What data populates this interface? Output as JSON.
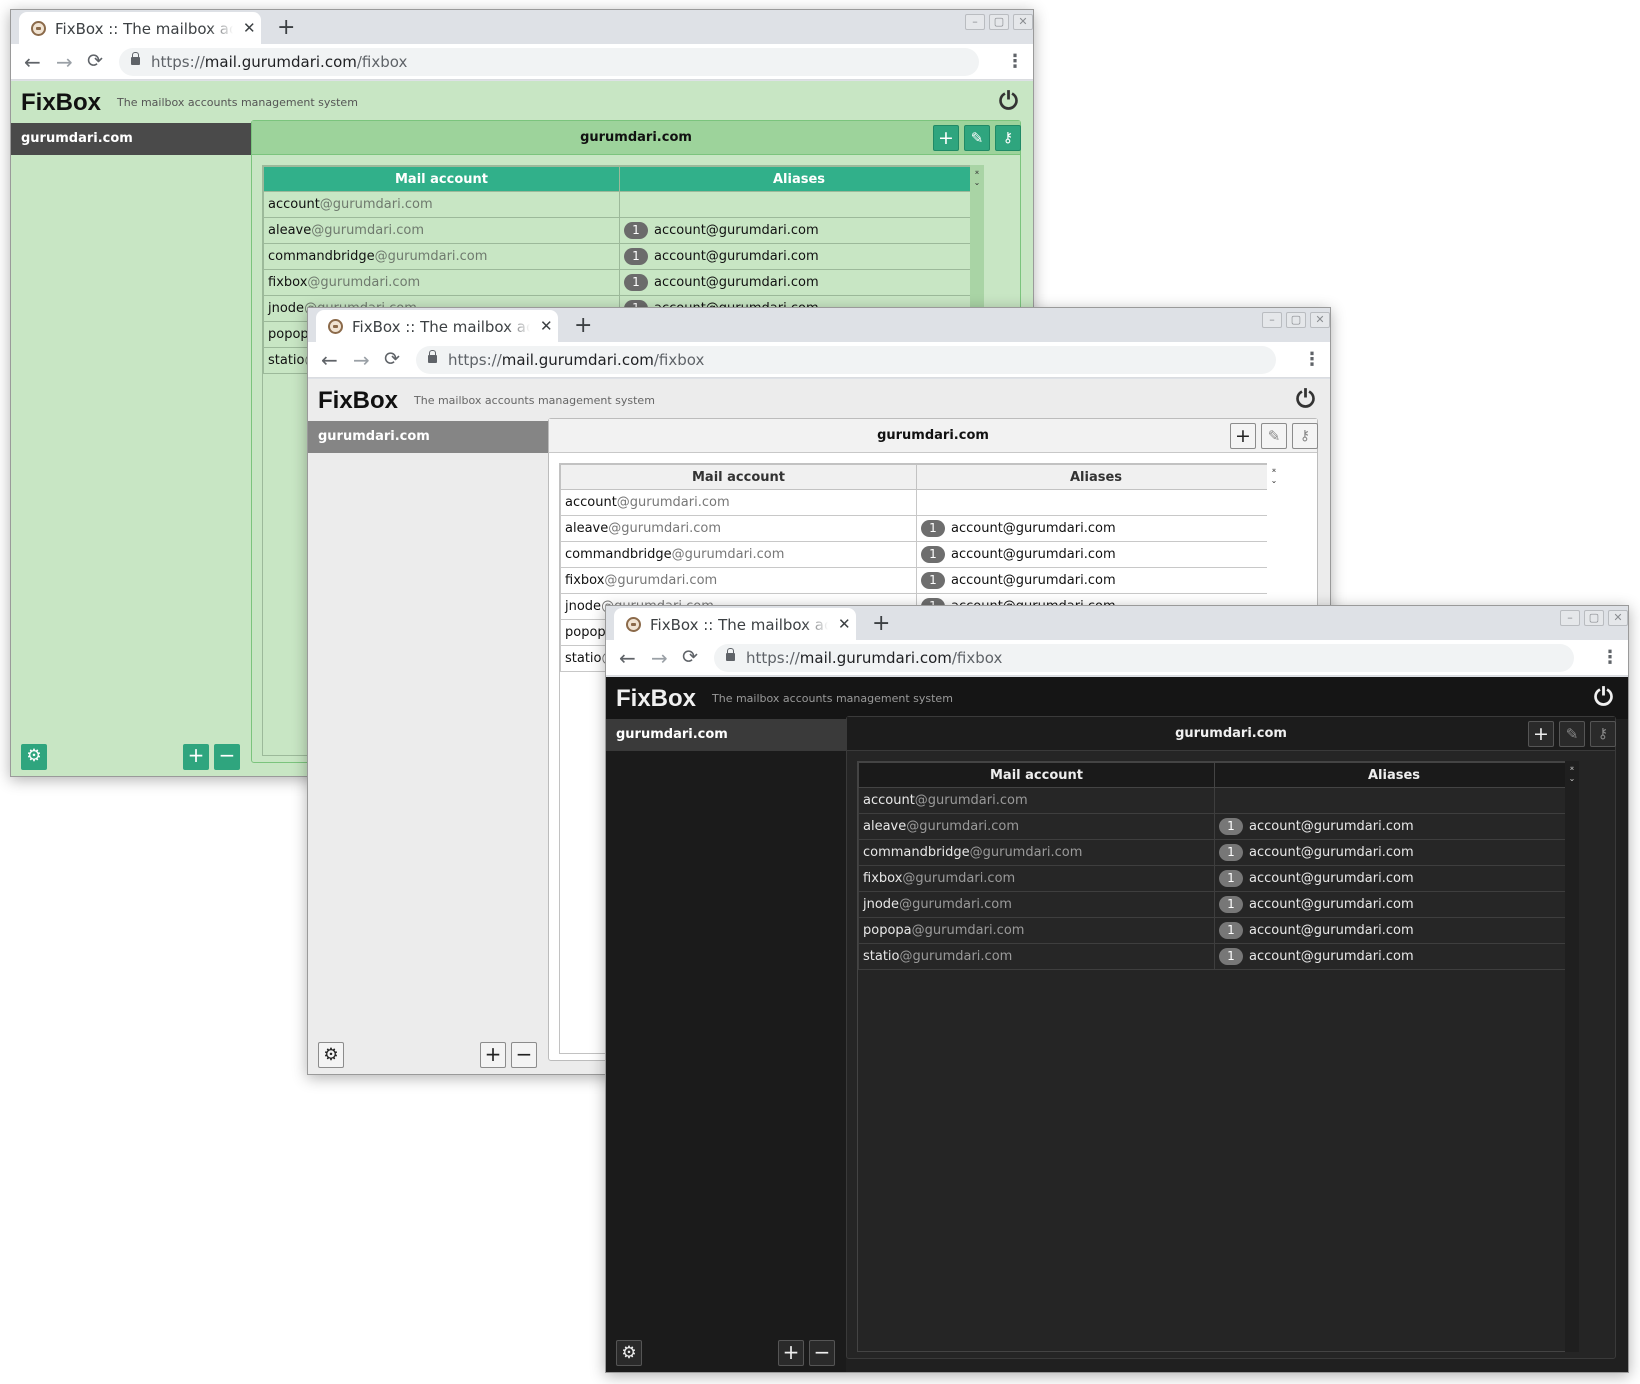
{
  "browser": {
    "tab_title": "FixBox :: The mailbox accounts management system",
    "url_scheme": "https://",
    "url_host": "mail.gurumdari.com",
    "url_path": "/fixbox"
  },
  "app": {
    "logo": "FixBox",
    "subtitle": "The mailbox accounts management system"
  },
  "sidebar": {
    "domains": [
      "gurumdari.com"
    ]
  },
  "panel": {
    "title": "gurumdari.com",
    "columns": [
      "Mail account",
      "Aliases"
    ],
    "rows": [
      {
        "user": "account",
        "domain": "@gurumdari.com",
        "alias_count": "",
        "alias": ""
      },
      {
        "user": "aleave",
        "domain": "@gurumdari.com",
        "alias_count": "1",
        "alias": "account@gurumdari.com"
      },
      {
        "user": "commandbridge",
        "domain": "@gurumdari.com",
        "alias_count": "1",
        "alias": "account@gurumdari.com"
      },
      {
        "user": "fixbox",
        "domain": "@gurumdari.com",
        "alias_count": "1",
        "alias": "account@gurumdari.com"
      },
      {
        "user": "jnode",
        "domain": "@gurumdari.com",
        "alias_count": "1",
        "alias": "account@gurumdari.com"
      },
      {
        "user": "popopa",
        "domain": "@gurumdari.com",
        "alias_count": "1",
        "alias": "account@gurumdari.com"
      },
      {
        "user": "statio",
        "domain": "@gurumdari.com",
        "alias_count": "1",
        "alias": "account@gurumdari.com"
      }
    ]
  },
  "icons": {
    "tab_close": "✕",
    "new_tab": "+",
    "back": "←",
    "forward": "→",
    "reload": "⟳",
    "star": "☆",
    "menu": "⋮",
    "power": "⏻",
    "gear": "⚙",
    "plus": "+",
    "minus": "−",
    "edit": "✎",
    "key": "⚷",
    "scroll_up": "⌅",
    "scroll_down": "⌄",
    "win_min": "–",
    "win_max": "▢",
    "win_close": "✕"
  },
  "themes": {
    "green": {
      "accent": "#2fa57e",
      "background": "#c8e6c4"
    },
    "gray": {
      "accent": "#858585",
      "background": "#ececec"
    },
    "dark": {
      "accent": "#3a3a3a",
      "background": "#202020"
    }
  }
}
